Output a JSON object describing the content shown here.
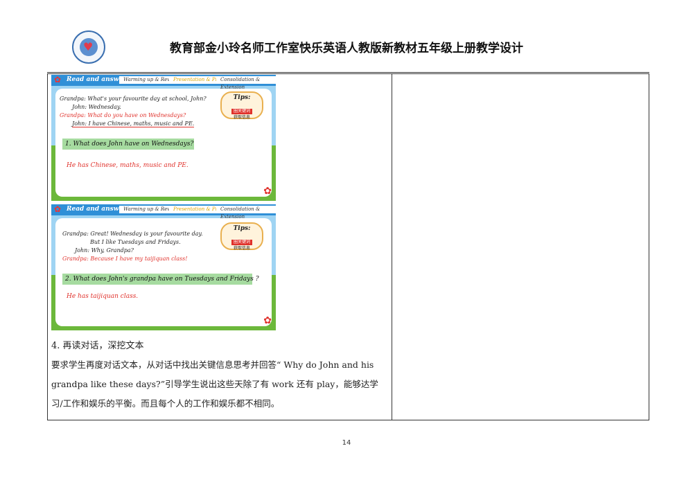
{
  "header": {
    "title": "教育部金小玲名师工作室快乐英语人教版新教材五年级上册教学设计"
  },
  "slides": [
    {
      "section_label": "Read and answer",
      "nav": [
        "Warming up & Revision",
        "Presentation & Practice",
        "Consolidation & Extension"
      ],
      "tips": {
        "title": "Tips:",
        "badge": "圈关键词",
        "note": "获取信息"
      },
      "dialogue": [
        "Grandpa: What's your favourite day at school, John?",
        "John: Wednesday.",
        "Grandpa: What do you have on Wednesdays?",
        "John: I have Chinese, maths, music and PE."
      ],
      "question": "1. What does John have on Wednesdays?",
      "answer": "He has Chinese, maths, music and PE."
    },
    {
      "section_label": "Read and answer",
      "nav": [
        "Warming up & Revision",
        "Presentation & Practice",
        "Consolidation & Extension"
      ],
      "tips": {
        "title": "Tips:",
        "badge": "圈关键词",
        "note": "获取信息"
      },
      "dialogue": [
        "Grandpa: Great! Wednesday is your favourite day.",
        "But I like Tuesdays and Fridays.",
        "John: Why, Grandpa?",
        "Grandpa: Because I have my taijiquan class!"
      ],
      "question": "2. What does John's grandpa have on Tuesdays and Fridays ?",
      "answer": "He has taijiquan class."
    }
  ],
  "body": {
    "step_title": "4. 再读对话，深挖文本",
    "paragraph": "要求学生再度对话文本，从对话中找出关键信息思考并回答“ Why do John and his grandpa like these days?”引导学生说出这些天除了有 work 还有 play，能够达学习/工作和娱乐的平衡。而且每个人的工作和娱乐都不相同。"
  },
  "footer": {
    "page_number": "14"
  }
}
